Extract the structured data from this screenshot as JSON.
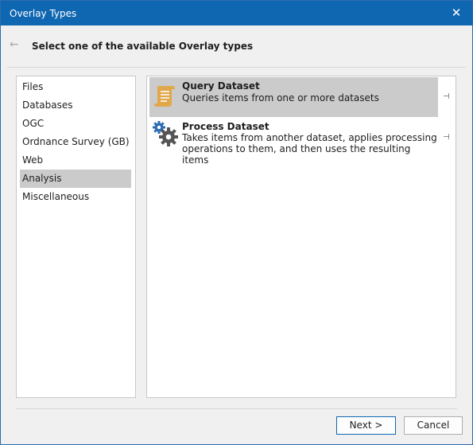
{
  "window": {
    "title": "Overlay Types",
    "close_glyph": "✕"
  },
  "header": {
    "back_glyph": "←",
    "subtitle": "Select one of the available Overlay types"
  },
  "categories": [
    {
      "label": "Files",
      "selected": false
    },
    {
      "label": "Databases",
      "selected": false
    },
    {
      "label": "OGC",
      "selected": false
    },
    {
      "label": "Ordnance Survey (GB)",
      "selected": false
    },
    {
      "label": "Web",
      "selected": false
    },
    {
      "label": "Analysis",
      "selected": true
    },
    {
      "label": "Miscellaneous",
      "selected": false
    }
  ],
  "overlays": [
    {
      "name": "Query Dataset",
      "description": [
        "Queries items from one or more datasets"
      ],
      "icon": "scroll-icon",
      "selected": true,
      "pin_glyph": "⊣"
    },
    {
      "name": "Process Dataset",
      "description": [
        "Takes items from another dataset, applies processing",
        "operations to them, and then uses the resulting items"
      ],
      "icon": "gears-icon",
      "selected": false,
      "pin_glyph": "⊣"
    }
  ],
  "buttons": {
    "next": "Next >",
    "cancel": "Cancel"
  },
  "colors": {
    "titlebar": "#0f67b1",
    "selection": "#cbcbcb",
    "scroll_icon": "#e0a84a",
    "gear_blue": "#2e6db4",
    "gear_dark": "#555555"
  }
}
